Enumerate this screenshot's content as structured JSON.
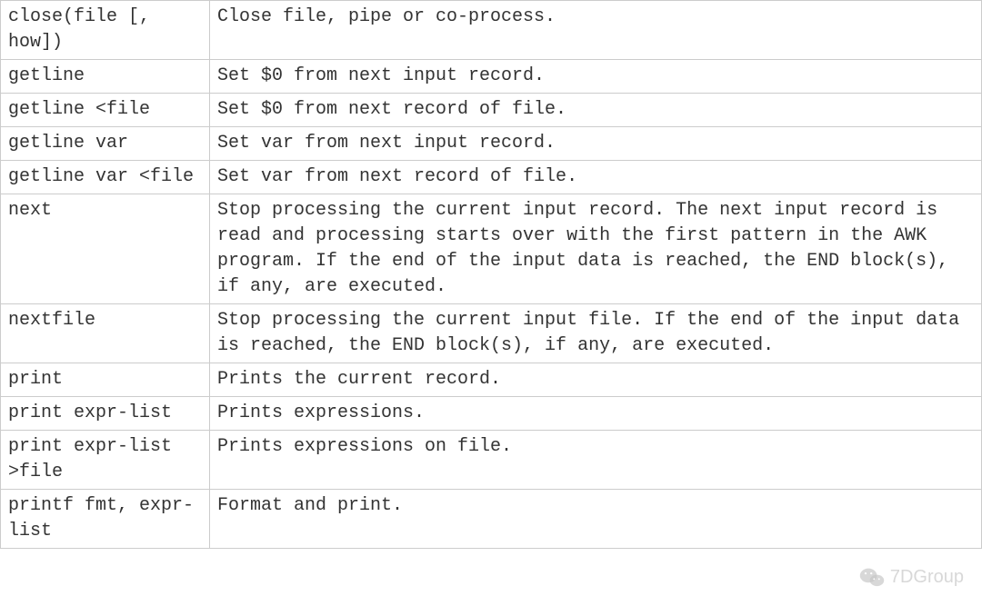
{
  "table": {
    "rows": [
      {
        "cmd": "close(file [, how])",
        "desc": "Close file, pipe or co-process."
      },
      {
        "cmd": "getline",
        "desc": "Set $0 from next input record."
      },
      {
        "cmd": "getline <file",
        "desc": "Set $0 from next record of file."
      },
      {
        "cmd": "getline var",
        "desc": "Set var from next input record."
      },
      {
        "cmd": "getline var <file",
        "desc": "Set var from next record of file."
      },
      {
        "cmd": "next",
        "desc": " Stop processing the current input record. The next input record is read and processing starts over with the first pattern in the AWK program. If the end of the input data is reached, the END block(s), if any, are executed."
      },
      {
        "cmd": "nextfile",
        "desc": "Stop processing the current input file. If the end of the input data is reached, the END block(s), if any, are executed."
      },
      {
        "cmd": "print",
        "desc": "Prints the current record."
      },
      {
        "cmd": "print expr-list",
        "desc": "Prints expressions."
      },
      {
        "cmd": "print expr-list >file",
        "desc": "Prints expressions on file."
      },
      {
        "cmd": "printf fmt, expr-list",
        "desc": "Format and print."
      }
    ]
  },
  "watermark": {
    "label": "7DGroup"
  }
}
